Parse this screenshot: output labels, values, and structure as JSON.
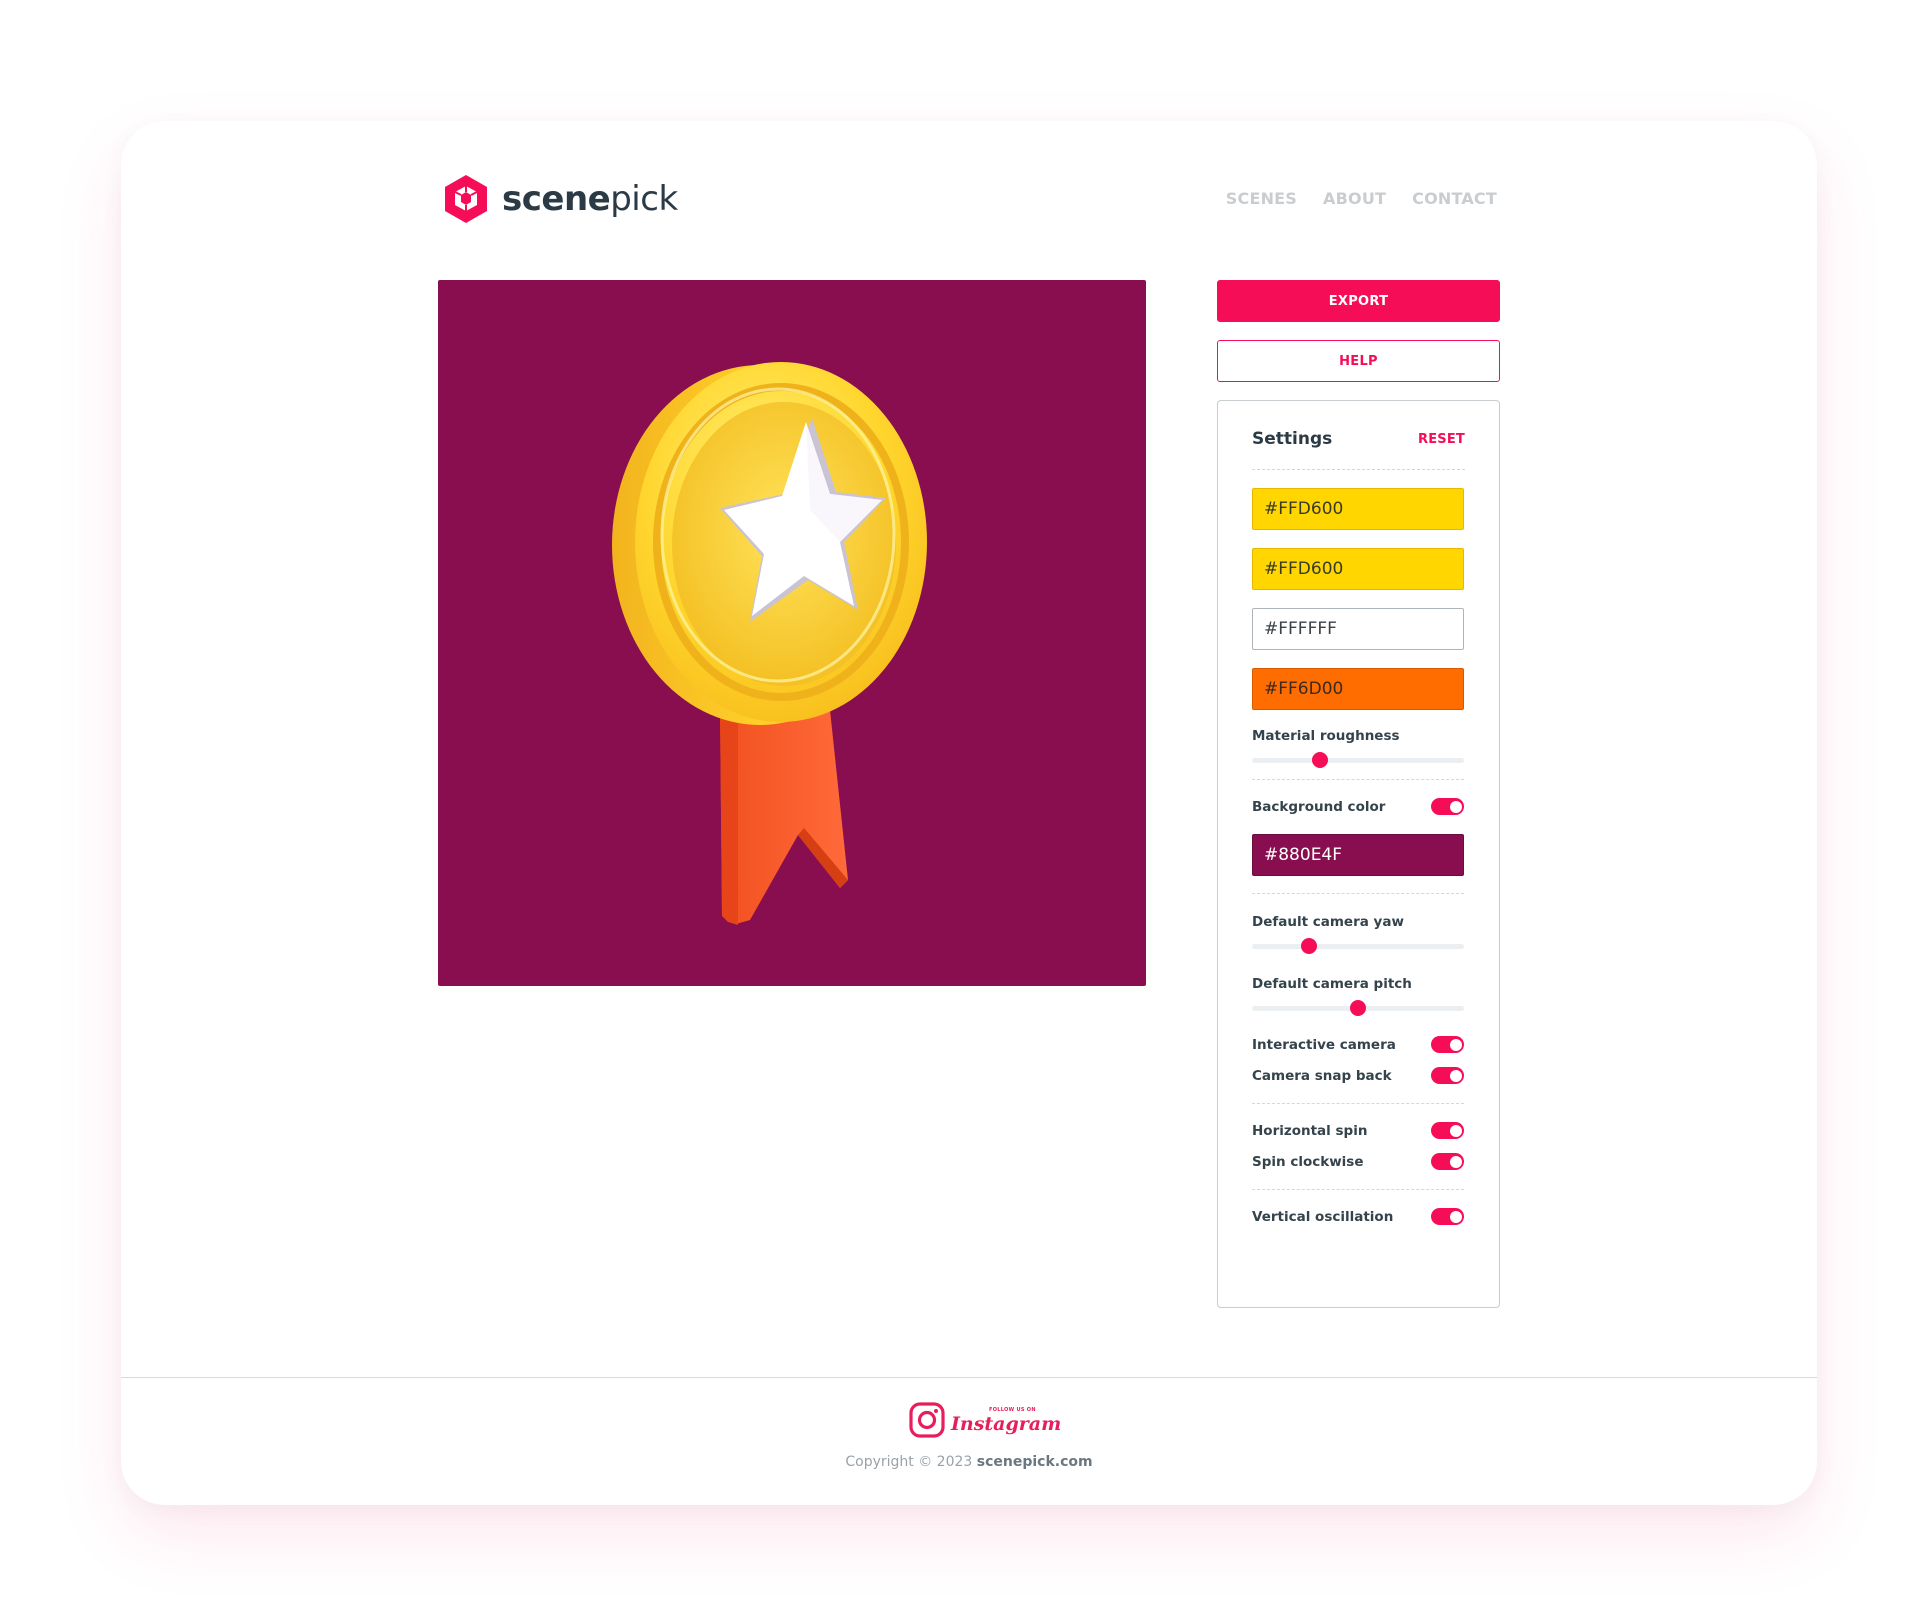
{
  "brand": {
    "name_bold": "scene",
    "name_light": "pick"
  },
  "nav": {
    "items": [
      "SCENES",
      "ABOUT",
      "CONTACT"
    ]
  },
  "actions": {
    "export_label": "EXPORT",
    "help_label": "HELP"
  },
  "settings": {
    "title": "Settings",
    "reset_label": "RESET",
    "colors": [
      {
        "value": "#FFD600",
        "swatch": "#ffd600"
      },
      {
        "value": "#FFD600",
        "swatch": "#ffd600"
      },
      {
        "value": "#FFFFFF",
        "swatch": "#ffffff"
      },
      {
        "value": "#FF6D00",
        "swatch": "#ff6d00"
      }
    ],
    "material_roughness": {
      "label": "Material roughness",
      "value": 0.32
    },
    "background_color": {
      "label": "Background color",
      "enabled": true,
      "value": "#880E4F"
    },
    "camera_yaw": {
      "label": "Default camera yaw",
      "value": 0.27
    },
    "camera_pitch": {
      "label": "Default camera pitch",
      "value": 0.5
    },
    "interactive_camera": {
      "label": "Interactive camera",
      "enabled": true
    },
    "camera_snap_back": {
      "label": "Camera snap back",
      "enabled": true
    },
    "horizontal_spin": {
      "label": "Horizontal spin",
      "enabled": true
    },
    "spin_clockwise": {
      "label": "Spin clockwise",
      "enabled": true
    },
    "vertical_oscillation": {
      "label": "Vertical oscillation",
      "enabled": true
    }
  },
  "scene": {
    "background": "#880e4f",
    "object": "medal-with-star-and-ribbon"
  },
  "footer": {
    "instagram_small": "FOLLOW US ON",
    "instagram_word": "Instagram",
    "copyright_prefix": "Copyright © 2023 ",
    "copyright_site": "scenepick.com"
  },
  "colors": {
    "accent": "#f50e57",
    "text": "#2b3a44",
    "muted": "#c9cdd0"
  }
}
